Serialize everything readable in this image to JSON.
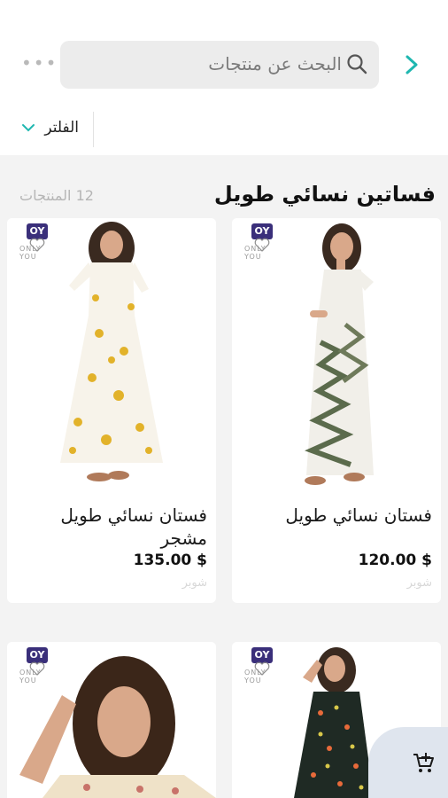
{
  "header": {
    "search_placeholder": "البحث عن منتجات",
    "more_icon": "more-dots-icon",
    "back_icon": "chevron-right-icon",
    "accent_color": "#1fb7b0"
  },
  "filter": {
    "label": "الفلتر"
  },
  "listing": {
    "title": "فساتين نسائي طويل",
    "count": "12 المنتجات"
  },
  "products": [
    {
      "name": "فستان نسائي طويل",
      "price": "120.00 $",
      "seller": "شوبر",
      "brand": "OY"
    },
    {
      "name": "فستان نسائي طويل مشجر",
      "price": "135.00 $",
      "seller": "شوبر",
      "brand": "OY"
    },
    {
      "name": "",
      "price": "",
      "seller": "",
      "brand": "OY"
    },
    {
      "name": "",
      "price": "",
      "seller": "",
      "brand": "OY"
    }
  ],
  "brand_caption": "ONLY YOU",
  "cart": {
    "icon": "add-to-cart-icon"
  }
}
